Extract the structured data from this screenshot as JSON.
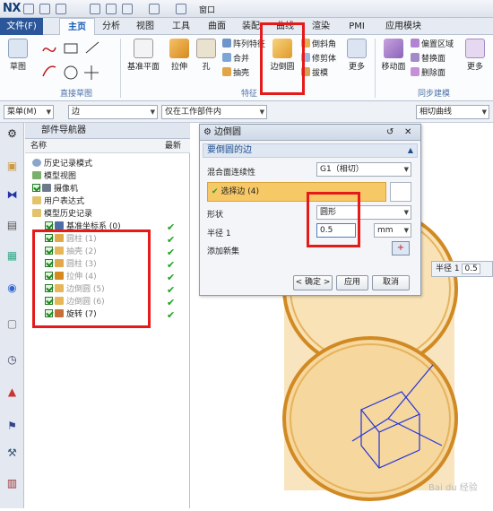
{
  "app": {
    "logo": "NX",
    "window_menu": "窗口"
  },
  "tabs": [
    "文件(F)",
    "主页",
    "分析",
    "视图",
    "工具",
    "曲面",
    "装配",
    "曲线",
    "渲染",
    "PMI",
    "应用模块"
  ],
  "ribbon": {
    "sketch": "草图",
    "group_direct_sketch": "直接草图",
    "datum_plane": "基准平面",
    "extrude": "拉伸",
    "hole": "孔",
    "array_feature": "阵列特征",
    "unite": "合并",
    "shell": "抽壳",
    "edge_blend": "边倒圆",
    "chamfer": "倒斜角",
    "trim_body": "修剪体",
    "draft": "拔模",
    "more": "更多",
    "group_feature": "特征",
    "move_face": "移动面",
    "offset_region": "偏置区域",
    "replace_face": "替换面",
    "delete_face": "删除面",
    "more2": "更多",
    "group_sync": "同步建模"
  },
  "toolbar2": {
    "menu": "菜单(M)",
    "filter": "边",
    "scope": "仅在工作部件内",
    "curve_rule": "相切曲线"
  },
  "navigator": {
    "title": "部件导航器",
    "col_name": "名称",
    "col_latest": "最新",
    "items": [
      "历史记录模式",
      "模型视图",
      "摄像机",
      "用户表达式",
      "模型历史记录",
      "基准坐标系 (0)",
      "圆柱 (1)",
      "抽壳 (2)",
      "圆柱 (3)",
      "拉伸 (4)",
      "边倒圆 (5)",
      "边倒圆 (6)",
      "旋转 (7)"
    ]
  },
  "dialog": {
    "title": "边倒圆",
    "section": "要倒圆的边",
    "continuity_label": "混合面连续性",
    "continuity_value": "G1（相切）",
    "select_edge": "选择边 (4)",
    "shape_label": "形状",
    "shape_value": "圆形",
    "radius_label": "半径 1",
    "radius_value": "0.5",
    "unit": "mm",
    "add_set": "添加新集",
    "ok": "< 确定 >",
    "apply": "应用",
    "cancel": "取消"
  },
  "viewport": {
    "radius_label": "半径 1",
    "radius_value": "0.5",
    "watermark": "Bai du 经验"
  }
}
